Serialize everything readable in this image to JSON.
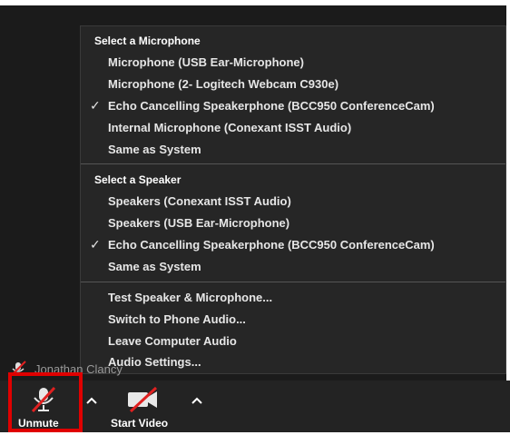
{
  "menu": {
    "microphone_header": "Select a Microphone",
    "microphones": [
      {
        "label": "Microphone (USB Ear-Microphone)",
        "checked": false
      },
      {
        "label": "Microphone (2- Logitech Webcam C930e)",
        "checked": false
      },
      {
        "label": "Echo Cancelling Speakerphone (BCC950 ConferenceCam)",
        "checked": true
      },
      {
        "label": "Internal Microphone (Conexant ISST Audio)",
        "checked": false
      },
      {
        "label": "Same as System",
        "checked": false
      }
    ],
    "speaker_header": "Select a Speaker",
    "speakers": [
      {
        "label": "Speakers (Conexant ISST Audio)",
        "checked": false
      },
      {
        "label": "Speakers (USB Ear-Microphone)",
        "checked": false
      },
      {
        "label": "Echo Cancelling Speakerphone (BCC950 ConferenceCam)",
        "checked": true
      },
      {
        "label": "Same as System",
        "checked": false
      }
    ],
    "actions": [
      {
        "label": "Test Speaker & Microphone..."
      },
      {
        "label": "Switch to Phone Audio..."
      },
      {
        "label": "Leave Computer Audio"
      },
      {
        "label": "Audio Settings..."
      }
    ],
    "checkmark": "✓"
  },
  "participant": {
    "name": "Jonathan Clancy"
  },
  "toolbar": {
    "unmute_label": "Unmute",
    "start_video_label": "Start Video",
    "unmute_icon": "microphone-muted-icon",
    "video_icon": "video-camera-off-icon",
    "caret": "^"
  },
  "colors": {
    "background": "#1b1b1b",
    "menu": "#262626",
    "highlight": "#e00000",
    "slash": "#e02020"
  }
}
